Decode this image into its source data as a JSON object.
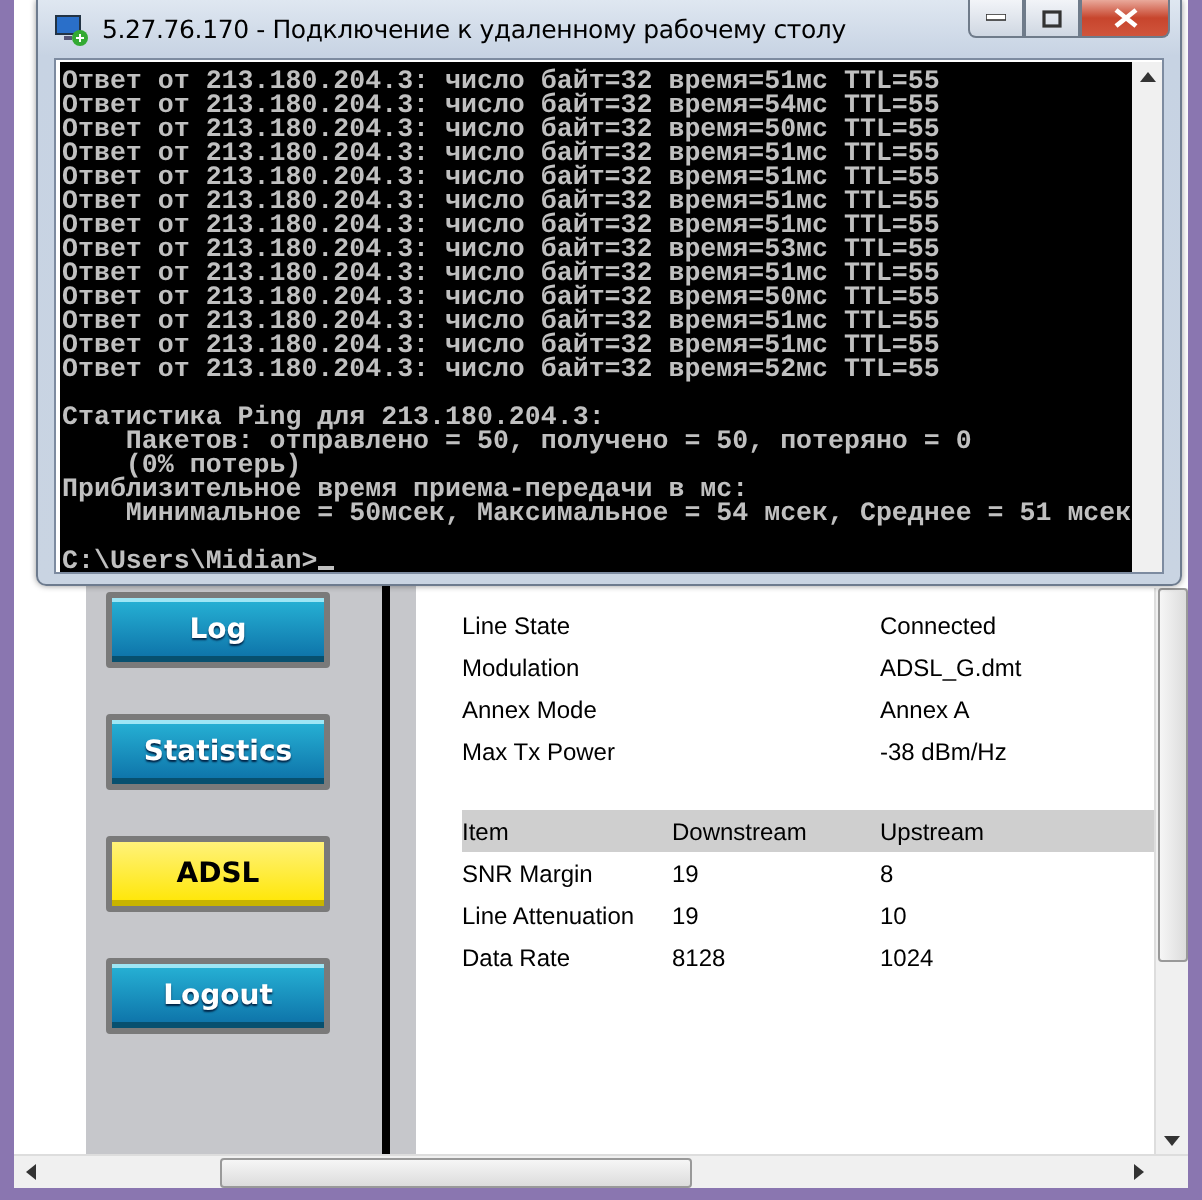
{
  "console_window": {
    "title": "5.27.76.170 - Подключение к удаленному рабочему столу",
    "replies": [
      "Ответ от 213.180.204.3: число байт=32 время=51мс TTL=55",
      "Ответ от 213.180.204.3: число байт=32 время=54мс TTL=55",
      "Ответ от 213.180.204.3: число байт=32 время=50мс TTL=55",
      "Ответ от 213.180.204.3: число байт=32 время=51мс TTL=55",
      "Ответ от 213.180.204.3: число байт=32 время=51мс TTL=55",
      "Ответ от 213.180.204.3: число байт=32 время=51мс TTL=55",
      "Ответ от 213.180.204.3: число байт=32 время=51мс TTL=55",
      "Ответ от 213.180.204.3: число байт=32 время=53мс TTL=55",
      "Ответ от 213.180.204.3: число байт=32 время=51мс TTL=55",
      "Ответ от 213.180.204.3: число байт=32 время=50мс TTL=55",
      "Ответ от 213.180.204.3: число байт=32 время=51мс TTL=55",
      "Ответ от 213.180.204.3: число байт=32 время=51мс TTL=55",
      "Ответ от 213.180.204.3: число байт=32 время=52мс TTL=55"
    ],
    "statistics": [
      "Статистика Ping для 213.180.204.3:",
      "    Пакетов: отправлено = 50, получено = 50, потеряно = 0",
      "    (0% потерь)",
      "Приблизительное время приема-передачи в мс:",
      "    Минимальное = 50мсек, Максимальное = 54 мсек, Среднее = 51 мсек"
    ],
    "prompt": "C:\\Users\\Midian>"
  },
  "sidebar": {
    "items": [
      {
        "label": "Log",
        "selected": false
      },
      {
        "label": "Statistics",
        "selected": false
      },
      {
        "label": "ADSL",
        "selected": true
      },
      {
        "label": "Logout",
        "selected": false
      }
    ]
  },
  "status": {
    "rows": [
      {
        "label": "Line State",
        "value": "Connected"
      },
      {
        "label": "Modulation",
        "value": "ADSL_G.dmt"
      },
      {
        "label": "Annex Mode",
        "value": "Annex A"
      },
      {
        "label": "Max Tx Power",
        "value": "-38 dBm/Hz"
      }
    ]
  },
  "table": {
    "columns": [
      "Item",
      "Downstream",
      "Upstream"
    ],
    "rows": [
      [
        "SNR Margin",
        "19",
        "8"
      ],
      [
        "Line Attenuation",
        "19",
        "10"
      ],
      [
        "Data Rate",
        "8128",
        "1024"
      ]
    ]
  }
}
